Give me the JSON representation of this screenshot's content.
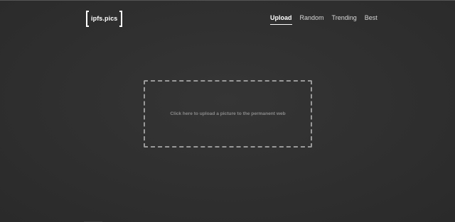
{
  "header": {
    "logo_text": "ipfs.pics",
    "nav": [
      {
        "label": "Upload",
        "active": true
      },
      {
        "label": "Random",
        "active": false
      },
      {
        "label": "Trending",
        "active": false
      },
      {
        "label": "Best",
        "active": false
      }
    ]
  },
  "main": {
    "upload_prompt": "Click here to upload a picture to the permanent web"
  },
  "colors": {
    "background": "#2e2e2e",
    "text_primary": "#ffffff",
    "dropzone_border": "#9a9a9a",
    "dropzone_text": "#8a8a8a"
  }
}
